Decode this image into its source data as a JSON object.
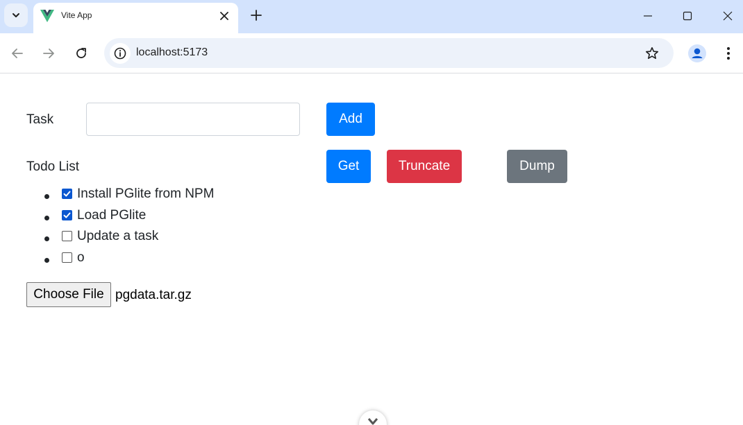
{
  "browser": {
    "tab_title": "Vite App",
    "url": "localhost:5173"
  },
  "icons": {
    "tab_menu": "chevron-down-icon",
    "favicon": "vue-logo-icon",
    "tab_close": "close-icon",
    "new_tab": "plus-icon",
    "back": "arrow-left-icon",
    "forward": "arrow-right-icon",
    "reload": "reload-icon",
    "site_info": "info-icon",
    "bookmark": "star-icon",
    "profile": "person-icon",
    "menu": "kebab-menu-icon"
  },
  "colors": {
    "primary": "#007bff",
    "danger": "#dc3545",
    "secondary": "#6c757d",
    "checkbox_checked": "#0b57d0"
  },
  "form": {
    "task_label": "Task",
    "task_value": "",
    "add_label": "Add"
  },
  "actions": {
    "get_label": "Get",
    "truncate_label": "Truncate",
    "dump_label": "Dump"
  },
  "todo": {
    "title": "Todo List",
    "items": [
      {
        "text": "Install PGlite from NPM",
        "done": true
      },
      {
        "text": "Load PGlite",
        "done": true
      },
      {
        "text": "Update a task",
        "done": false
      },
      {
        "text": "o",
        "done": false
      }
    ]
  },
  "file": {
    "button_label": "Choose File",
    "file_name": "pgdata.tar.gz"
  }
}
